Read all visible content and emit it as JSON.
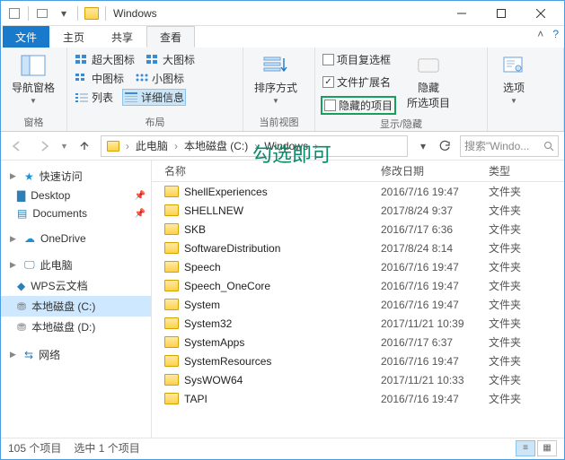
{
  "window": {
    "title": "Windows"
  },
  "tabs": {
    "file": "文件",
    "home": "主页",
    "share": "共享",
    "view": "查看"
  },
  "ribbon": {
    "group_panes": {
      "label": "窗格",
      "nav_pane": "导航窗格"
    },
    "group_layout": {
      "label": "布局",
      "xl_icons": "超大图标",
      "l_icons": "大图标",
      "m_icons": "中图标",
      "s_icons": "小图标",
      "list": "列表",
      "details": "详细信息"
    },
    "group_current": {
      "label": "当前视图",
      "sort": "排序方式"
    },
    "group_showhide": {
      "label": "显示/隐藏",
      "item_checkboxes": "项目复选框",
      "file_ext": "文件扩展名",
      "hidden_items": "隐藏的项目",
      "hide_selected": "隐藏\n所选项目"
    },
    "group_options": {
      "options": "选项"
    }
  },
  "overlay": {
    "text": "勾选即可"
  },
  "breadcrumb": {
    "pc": "此电脑",
    "drive": "本地磁盘 (C:)",
    "folder": "Windows"
  },
  "search": {
    "placeholder": "搜索\"Windo..."
  },
  "sidebar": {
    "quick": "快速访问",
    "desktop": "Desktop",
    "documents": "Documents",
    "onedrive": "OneDrive",
    "thispc": "此电脑",
    "wps": "WPS云文档",
    "drive_c": "本地磁盘 (C:)",
    "drive_d": "本地磁盘 (D:)",
    "network": "网络"
  },
  "columns": {
    "name": "名称",
    "date": "修改日期",
    "type": "类型"
  },
  "rows": [
    {
      "name": "ShellExperiences",
      "date": "2016/7/16 19:47",
      "type": "文件夹"
    },
    {
      "name": "SHELLNEW",
      "date": "2017/8/24 9:37",
      "type": "文件夹"
    },
    {
      "name": "SKB",
      "date": "2016/7/17 6:36",
      "type": "文件夹"
    },
    {
      "name": "SoftwareDistribution",
      "date": "2017/8/24 8:14",
      "type": "文件夹"
    },
    {
      "name": "Speech",
      "date": "2016/7/16 19:47",
      "type": "文件夹"
    },
    {
      "name": "Speech_OneCore",
      "date": "2016/7/16 19:47",
      "type": "文件夹"
    },
    {
      "name": "System",
      "date": "2016/7/16 19:47",
      "type": "文件夹"
    },
    {
      "name": "System32",
      "date": "2017/11/21 10:39",
      "type": "文件夹"
    },
    {
      "name": "SystemApps",
      "date": "2016/7/17 6:37",
      "type": "文件夹"
    },
    {
      "name": "SystemResources",
      "date": "2016/7/16 19:47",
      "type": "文件夹"
    },
    {
      "name": "SysWOW64",
      "date": "2017/11/21 10:33",
      "type": "文件夹"
    },
    {
      "name": "TAPI",
      "date": "2016/7/16 19:47",
      "type": "文件夹"
    }
  ],
  "status": {
    "count": "105 个项目",
    "selected": "选中 1 个项目"
  }
}
